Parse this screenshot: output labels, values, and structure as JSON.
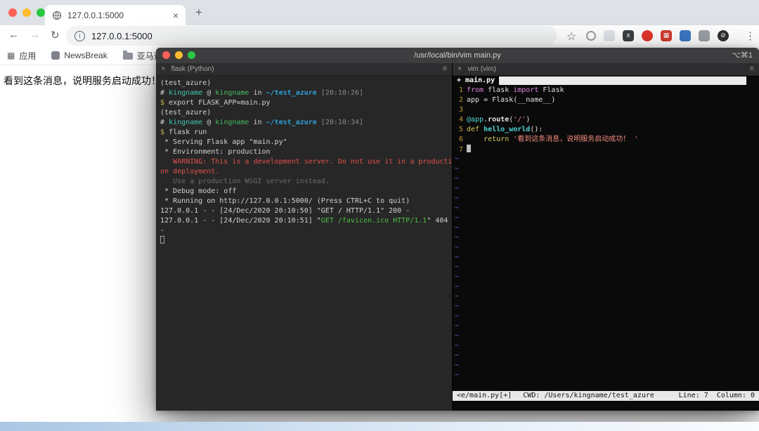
{
  "browser": {
    "tab_title": "127.0.0.1:5000",
    "url": "127.0.0.1:5000",
    "icons": {
      "close_tab": "×",
      "new_tab": "+",
      "back": "←",
      "forward": "→",
      "reload": "↻",
      "info": "i",
      "star": "☆",
      "menu": "⋮",
      "apps_grid": "▦"
    },
    "bookmarks": [
      {
        "label": "应用",
        "icon": "apps-grid-icon"
      },
      {
        "label": "NewsBreak",
        "icon": "site-favicon-icon"
      },
      {
        "label": "亚马逊批量",
        "icon": "folder-icon"
      }
    ],
    "extensions": [
      {
        "name": "ring-extension-icon",
        "shape": "ring",
        "color": "#9aa0a6",
        "glyph": ""
      },
      {
        "name": "card-extension-icon",
        "shape": "square",
        "color": "#dfe3e8",
        "glyph": ""
      },
      {
        "name": "x-square-extension-icon",
        "shape": "square",
        "color": "#3b4043",
        "glyph": "x"
      },
      {
        "name": "red-circle-extension-icon",
        "shape": "circle",
        "color": "#e1372c",
        "glyph": ""
      },
      {
        "name": "red-grid-extension-icon",
        "shape": "square",
        "color": "#d33a2f",
        "glyph": "▦"
      },
      {
        "name": "blue-extension-icon",
        "shape": "square",
        "color": "#3b78c2",
        "glyph": ""
      },
      {
        "name": "puzzle-extension-icon",
        "shape": "square",
        "color": "#9aa0a6",
        "glyph": ""
      },
      {
        "name": "profile-avatar-icon",
        "shape": "circle",
        "color": "#2d2f31",
        "glyph": "⊘"
      }
    ]
  },
  "page": {
    "message": "看到这条消息，说明服务启动成功！"
  },
  "terminal": {
    "title": "/usr/local/bin/vim main.py",
    "shortcut": "⌥⌘1",
    "icons": {
      "close": "×",
      "menu": "≡"
    },
    "left_pane": {
      "tab_label": "flask (Python)",
      "lines": [
        [
          {
            "t": "(test_azure)",
            "c": "tw"
          }
        ],
        [
          {
            "t": "# ",
            "c": "tw"
          },
          {
            "t": "kingname",
            "c": "tcyan"
          },
          {
            "t": " @ ",
            "c": "tw"
          },
          {
            "t": "kingname",
            "c": "thost"
          },
          {
            "t": " in ",
            "c": "tw"
          },
          {
            "t": "~/test_azure",
            "c": "tblue tb"
          },
          {
            "t": " [20:10:26]",
            "c": "tdim"
          }
        ],
        [
          {
            "t": "$",
            "c": "tyellow"
          },
          {
            "t": " export FLASK_APP=main.py",
            "c": "tw"
          }
        ],
        [
          {
            "t": "(test_azure)",
            "c": "tw"
          }
        ],
        [
          {
            "t": "# ",
            "c": "tw"
          },
          {
            "t": "kingname",
            "c": "tcyan"
          },
          {
            "t": " @ ",
            "c": "tw"
          },
          {
            "t": "kingname",
            "c": "thost"
          },
          {
            "t": " in ",
            "c": "tw"
          },
          {
            "t": "~/test_azure",
            "c": "tblue tb"
          },
          {
            "t": " [20:10:34]",
            "c": "tdim"
          }
        ],
        [
          {
            "t": "$",
            "c": "tyellow"
          },
          {
            "t": " flask run",
            "c": "tw"
          }
        ],
        [
          {
            "t": " * Serving Flask app \"main.py\"",
            "c": "tw"
          }
        ],
        [
          {
            "t": " * Environment: production",
            "c": "tw"
          }
        ],
        [
          {
            "t": "   WARNING: This is a development server. Do not use it in a producti",
            "c": "tred"
          }
        ],
        [
          {
            "t": "on deployment.",
            "c": "tred"
          }
        ],
        [
          {
            "t": "   Use a production WSGI server instead.",
            "c": "tgray"
          }
        ],
        [
          {
            "t": " * Debug mode: off",
            "c": "tw"
          }
        ],
        [
          {
            "t": " * Running on http://127.0.0.1:5000/ (Press CTRL+C to quit)",
            "c": "tw"
          }
        ],
        [
          {
            "t": "127.0.0.1 - - [24/Dec/2020 20:10:50] \"GET / HTTP/1.1\" 200 -",
            "c": "tw"
          }
        ],
        [
          {
            "t": "127.0.0.1 - - [24/Dec/2020 20:10:51] \"",
            "c": "tw"
          },
          {
            "t": "GET /favicon.ico HTTP/1.1",
            "c": "tgreen"
          },
          {
            "t": "\" 404",
            "c": "tw"
          }
        ],
        [
          {
            "t": "-",
            "c": "tw"
          }
        ],
        [
          {
            "t": "",
            "c": "cursor-hollow",
            "n": "terminal-cursor"
          }
        ]
      ]
    },
    "vim": {
      "tab_label": "vim (vim)",
      "buffer_tab": "+ main.py",
      "tilde_char": "~",
      "tilde_count": 23,
      "lines": [
        {
          "n": "1",
          "segs": [
            {
              "t": "from",
              "c": "vpink"
            },
            {
              "t": " flask ",
              "c": "vw"
            },
            {
              "t": "import",
              "c": "vpink"
            },
            {
              "t": " Flask",
              "c": "vw"
            }
          ]
        },
        {
          "n": "2",
          "segs": [
            {
              "t": "app = Flask(__name__)",
              "c": "vw"
            }
          ]
        },
        {
          "n": "3",
          "segs": []
        },
        {
          "n": "4",
          "segs": [
            {
              "t": "@app",
              "c": "vcyan"
            },
            {
              "t": ".",
              "c": "vw"
            },
            {
              "t": "route",
              "c": "vw vb"
            },
            {
              "t": "(",
              "c": "vw"
            },
            {
              "t": "'/'",
              "c": "vred"
            },
            {
              "t": ")",
              "c": "vw"
            }
          ]
        },
        {
          "n": "5",
          "segs": [
            {
              "t": "def",
              "c": "vyellow"
            },
            {
              "t": " ",
              "c": "vw"
            },
            {
              "t": "hello_world",
              "c": "vcyan vb"
            },
            {
              "t": "():",
              "c": "vw"
            }
          ]
        },
        {
          "n": "6",
          "segs": [
            {
              "t": "    ",
              "c": "vw"
            },
            {
              "t": "return",
              "c": "vyellow"
            },
            {
              "t": " ",
              "c": "vw"
            },
            {
              "t": "'看到这条消息，说明服务启动成功！ '",
              "c": "vred"
            }
          ]
        },
        {
          "n": "7",
          "segs": [],
          "cursor": true
        }
      ],
      "status": {
        "file": "<e/main.py[+]",
        "cwd": "CWD: /Users/kingname/test_azure",
        "position": "Line: 7  Column: 0"
      }
    }
  },
  "palette": {
    "traffic_red": "#ff5f57",
    "traffic_yellow": "#febc2e",
    "traffic_green": "#28c841",
    "terminal_warning_red": "#df5149",
    "terminal_prompt_cyan": "#3ec5ad",
    "vim_string_red": "#f08a7e",
    "vim_keyword_yellow": "#d9c95a",
    "vim_linenr_gold": "#c4973f",
    "vim_tilde_blue": "#6565d8"
  }
}
